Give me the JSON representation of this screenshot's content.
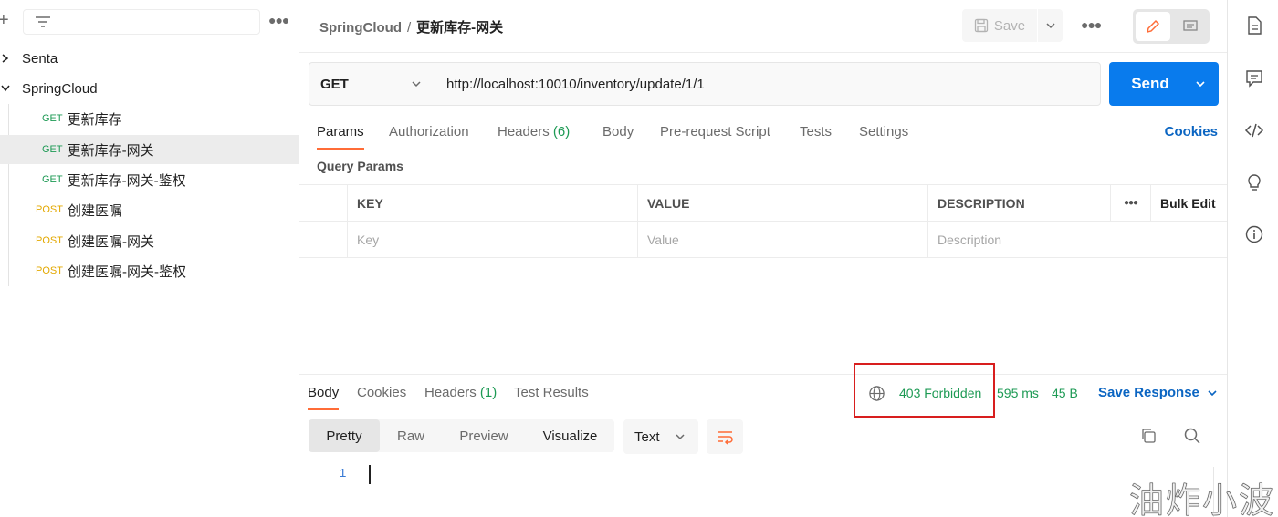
{
  "sidebar": {
    "folders": [
      {
        "label": "Senta",
        "expanded": false
      },
      {
        "label": "SpringCloud",
        "expanded": true
      }
    ],
    "requests": [
      {
        "method": "GET",
        "label": "更新库存",
        "selected": false
      },
      {
        "method": "GET",
        "label": "更新库存-网关",
        "selected": true
      },
      {
        "method": "GET",
        "label": "更新库存-网关-鉴权",
        "selected": false
      },
      {
        "method": "POST",
        "label": "创建医嘱",
        "selected": false
      },
      {
        "method": "POST",
        "label": "创建医嘱-网关",
        "selected": false
      },
      {
        "method": "POST",
        "label": "创建医嘱-网关-鉴权",
        "selected": false
      }
    ]
  },
  "header": {
    "collection": "SpringCloud",
    "separator": "/",
    "request_name": "更新库存-网关",
    "save_label": "Save"
  },
  "request": {
    "method": "GET",
    "url": "http://localhost:10010/inventory/update/1/1",
    "send_label": "Send"
  },
  "req_tabs": {
    "params": "Params",
    "authorization": "Authorization",
    "headers": "Headers",
    "headers_count": "(6)",
    "body": "Body",
    "prerequest": "Pre-request Script",
    "tests": "Tests",
    "settings": "Settings",
    "cookies": "Cookies"
  },
  "query_params": {
    "title": "Query Params",
    "columns": {
      "key": "KEY",
      "value": "VALUE",
      "description": "DESCRIPTION",
      "bulk_edit": "Bulk Edit"
    },
    "placeholders": {
      "key": "Key",
      "value": "Value",
      "description": "Description"
    }
  },
  "response": {
    "tabs": {
      "body": "Body",
      "cookies": "Cookies",
      "headers": "Headers",
      "headers_count": "(1)",
      "tests": "Test Results"
    },
    "status": "403 Forbidden",
    "time": "595 ms",
    "size": "45 B",
    "save_response": "Save Response",
    "formats": {
      "pretty": "Pretty",
      "raw": "Raw",
      "preview": "Preview",
      "visualize": "Visualize"
    },
    "language": "Text",
    "line_number": "1"
  },
  "watermark": "油炸小波",
  "colors": {
    "accent": "#ff6c37",
    "send": "#097bed",
    "get": "#1d9a54",
    "post": "#e3a800",
    "highlight": "#d81e1e"
  }
}
